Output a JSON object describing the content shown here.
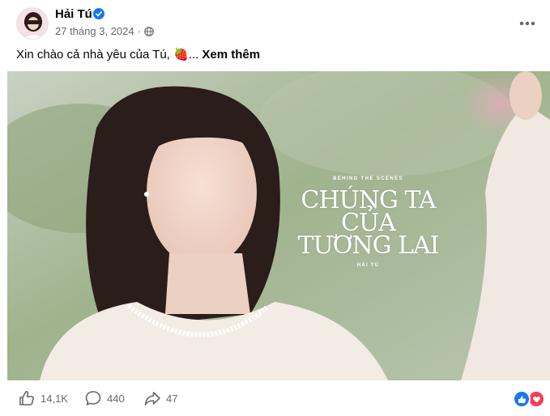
{
  "post": {
    "author": "Hải Tú",
    "date": "27 tháng 3, 2024",
    "separator": "·",
    "privacy_icon": "globe-icon",
    "more_icon": "more-horizontal-icon",
    "caption_text": "Xin chào cả nhà yêu của Tú, 🍓...",
    "see_more": "Xem thêm"
  },
  "media": {
    "overlay_small": "BEHIND THE SCENES",
    "overlay_title_lines": [
      "CHÚNG TA",
      "CỦA",
      "TƯƠNG LAI"
    ],
    "overlay_artist": "HẢI TÚ"
  },
  "footer": {
    "likes": "14,1K",
    "comments": "440",
    "shares": "47",
    "reaction_icons": [
      "like-reaction-icon",
      "love-reaction-icon"
    ]
  },
  "colors": {
    "text_primary": "#050505",
    "text_secondary": "#65676b",
    "brand_blue": "#1877f2",
    "love_red": "#f33e58"
  }
}
